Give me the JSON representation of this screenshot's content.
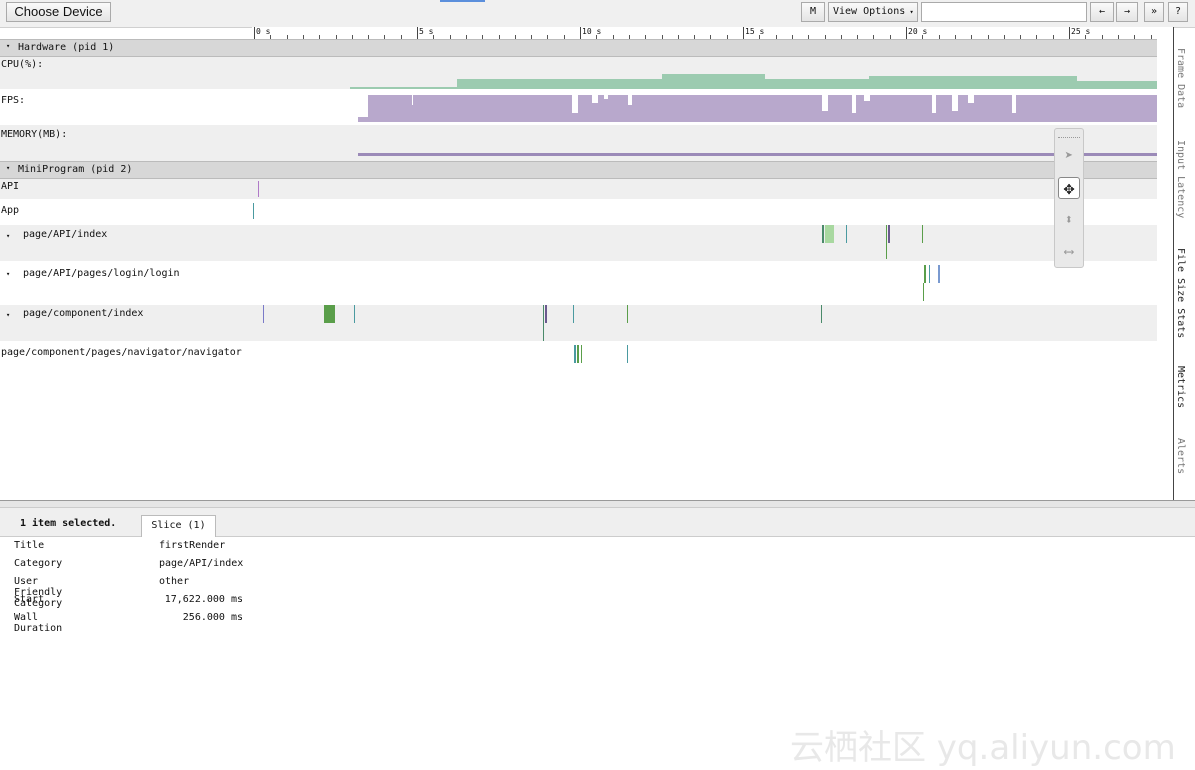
{
  "toolbar": {
    "choose_device": "Choose Device",
    "m_button": "M",
    "view_options": "View Options",
    "search_value": "",
    "prev_label": "←",
    "next_label": "→",
    "more_label": "»",
    "help_label": "?"
  },
  "ruler": [
    "0 s",
    "5 s",
    "10 s",
    "15 s",
    "20 s",
    "25 s"
  ],
  "hardware": {
    "header": "Hardware (pid 1)",
    "tracks": [
      "CPU(%):",
      "FPS:",
      "MEMORY(MB):"
    ]
  },
  "miniprogram": {
    "header": "MiniProgram (pid 2)",
    "tracks": [
      "API",
      "App",
      "page/API/index",
      "page/API/pages/login/login",
      "page/component/index",
      "page/component/pages/navigator/navigator"
    ]
  },
  "side_tabs": [
    "Frame Data",
    "Input Latency",
    "File Size Stats",
    "Metrics",
    "Alerts"
  ],
  "bottom": {
    "selection": "1 item selected.",
    "tab": "Slice (1)",
    "props": [
      {
        "key": "Title",
        "value": "firstRender"
      },
      {
        "key": "Category",
        "value": "page/API/index"
      },
      {
        "key": "User Friendly Category",
        "value": "other"
      },
      {
        "key": "Start",
        "value": "17,622.000 ms"
      },
      {
        "key": "Wall Duration",
        "value": "256.000 ms"
      }
    ]
  },
  "watermark": "云栖社区 yq.aliyun.com",
  "colors": {
    "cpu": "#9ccbb0",
    "fps": "#b8a8cc",
    "memory": "#9b8ab8",
    "green": "#5a9e4a"
  }
}
